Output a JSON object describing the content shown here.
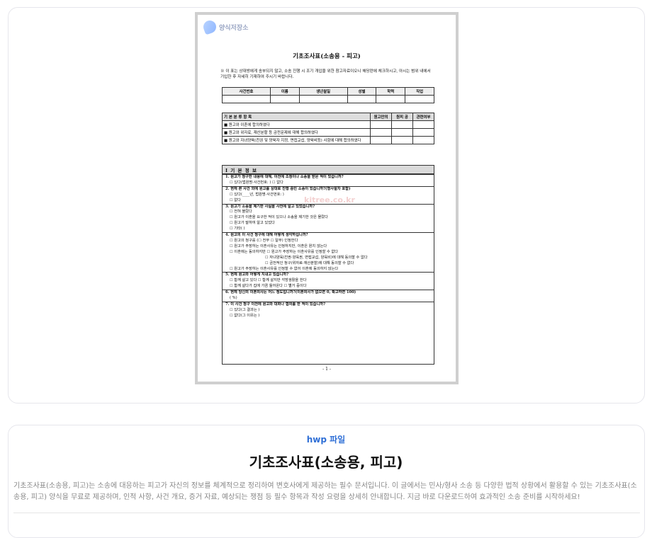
{
  "preview": {
    "logo_text": "양식저장소",
    "title": "기초조사표(소송용 - 피고)",
    "note": "※ 이 표는 상대방에게 송부되지 않고, 소송 진행 시 조기 개입을 위한 참고자료이오니 해당란에 체크하시고, 아시는 범위 내에서 기입한 후 자세히 기재하여 주시기 바랍니다.",
    "info_headers": [
      "사건번호",
      "이름",
      "생년월일",
      "성별",
      "학력",
      "직업"
    ],
    "check_head": [
      "기 본 분 류 항 목",
      "원고만의",
      "원피 공",
      "관련여부"
    ],
    "check_rows": [
      "■ 원고와 이혼에 합의하였다",
      "■ 원고와 위자료, 재산분할 등 금전문제에 대해 합의하였다",
      "■ 원고와 자녀양육(친권 및 양육자 지정, 면접교섭, 양육비등) 사항에 대해 합의하였다"
    ],
    "section_title": "Ⅰ  기 본 정 보",
    "questions": [
      {
        "cls": "q b",
        "text": "1. 원고가 청구한 내용에 대해, 이전에 조정이나 소송을 받은 적이 있습니까?"
      },
      {
        "cls": "q ind",
        "text": "☐ 있다(법원명·사건번호:                                  )     ☐ 없다"
      },
      {
        "cls": "q b",
        "text": "2. 현재 본 사건 외에 원고를 상대로 진행 중인 소송이 있습니까?(형사절차 포함)"
      },
      {
        "cls": "q ind",
        "text": "☐ 있다(____년, 법원명·사건번호:                                             )"
      },
      {
        "cls": "q ind",
        "text": "☐ 없다"
      },
      {
        "cls": "q b",
        "text": "3. 원고가 소송을 제기한 사실을 사전에 알고 있었습니까?"
      },
      {
        "cls": "q ind",
        "text": "☐ 전혀 몰랐다"
      },
      {
        "cls": "q ind",
        "text": "☐ 원고가 이혼을 요구한 적이 있으나 소송을 제기한 것은 몰랐다"
      },
      {
        "cls": "q ind",
        "text": "☐ 원고가 말하여 알고 있었다"
      },
      {
        "cls": "q ind",
        "text": "☐ 기타(                                                                      )"
      },
      {
        "cls": "q b",
        "text": "4. 원고의 이 사건 청구에 대해 어떻게 생각하십니까?"
      },
      {
        "cls": "q ind",
        "text": "☐ 원고의 청구를 (☐ 전부  ☐ 일부) 인정한다"
      },
      {
        "cls": "q ind",
        "text": "☐ 원고가 주장하는 이혼사유는 인정하지만, 이혼은 원치 않는다"
      },
      {
        "cls": "q ind",
        "text": "☐ 이혼에는 동의하지만 ☐ 원고가 주장하는 이혼사유를 인정할 수 없다"
      },
      {
        "cls": "q ind2",
        "text": "☐ 자녀양육(친권·양육권, 면접교섭, 양육비)에 대해 동의할 수 없다"
      },
      {
        "cls": "q ind2",
        "text": "☐ 금전적인 청구(위자료·재산분할)에 대해 동의할 수 없다"
      },
      {
        "cls": "q ind",
        "text": "☐ 원고가 주장하는 이혼사유를 인정할 수 없어 이혼에 동의하지 않는다"
      },
      {
        "cls": "q b",
        "text": "5. 현재 원고와 어떻게 지내고 있습니까?"
      },
      {
        "cls": "q ind",
        "text": "☐ 함께 살고 있다                     ☐ 함께 살지만 각방생활을 한다"
      },
      {
        "cls": "q ind",
        "text": "☐ 함께 살다가 집에 가끔 들어온다      ☐ 별거 중이다"
      },
      {
        "cls": "q b",
        "text": "6. 현재 당신의 이혼의사는 어느 정도입니까?(이혼의사가 없으면 0, 확고하면 100)"
      },
      {
        "cls": "q ind",
        "text": "(          %)"
      },
      {
        "cls": "q b",
        "text": "7. 이 사건 청구 이전에 원고와 대화나 협의를 한 적이 있습니까?"
      },
      {
        "cls": "q ind",
        "text": "☐ 있다(그 결과는                                                           )"
      },
      {
        "cls": "q ind",
        "text": "☐ 없다(그 이유는                                                           )"
      }
    ],
    "page_number": "- 1 -",
    "watermark": "kitree.co.kr"
  },
  "file_type": "hwp 파일",
  "main_title": "기초조사표(소송용, 피고)",
  "description": "기초조사표(소송용, 피고)는 소송에 대응하는 피고가 자신의 정보를 체계적으로 정리하여 변호사에게 제공하는 필수 문서입니다. 이 글에서는 민사/형사 소송 등 다양한 법적 상황에서 활용할 수 있는 기초조사표(소송용, 피고) 양식을 무료로 제공하며, 인적 사항, 사건 개요, 증거 자료, 예상되는 쟁점 등 필수 항목과 작성 요령을 상세히 안내합니다. 지금 바로 다운로드하여 효과적인 소송 준비를 시작하세요!"
}
